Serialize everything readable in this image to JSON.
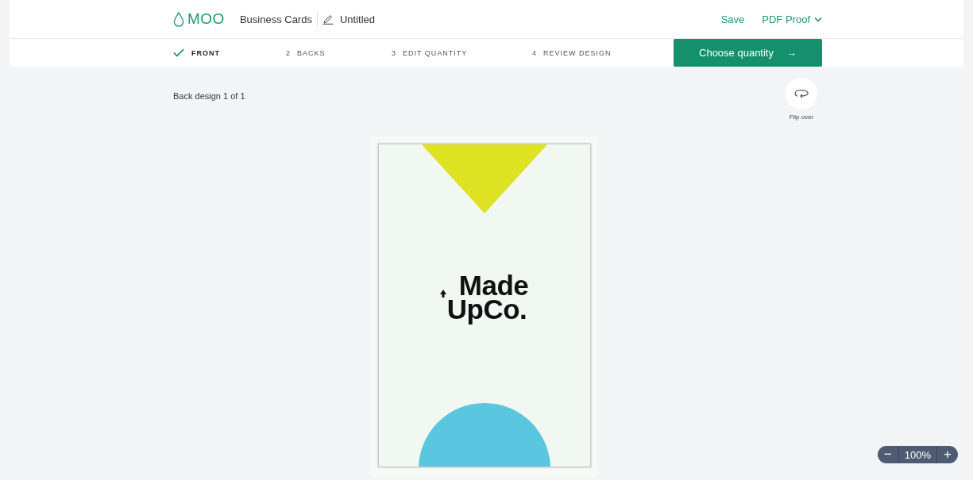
{
  "header": {
    "brand": "MOO",
    "product": "Business Cards",
    "document_title": "Untitled",
    "actions": [
      {
        "kind": "link",
        "label": "Save"
      },
      {
        "kind": "dropdown",
        "label": "PDF Proof"
      }
    ]
  },
  "steps": [
    {
      "label": "FRONT",
      "done": true,
      "selected": true
    },
    {
      "number": "2",
      "label": "BACKS",
      "done": false,
      "selected": false
    },
    {
      "number": "3",
      "label": "EDIT QUANTITY",
      "done": false,
      "selected": false
    },
    {
      "number": "4",
      "label": "REVIEW DESIGN",
      "done": false,
      "selected": false
    }
  ],
  "primary_button": {
    "label": "Choose quantity",
    "arrow": "→"
  },
  "design_label": "Back design 1 of 1",
  "flip": {
    "label": "Flip over"
  },
  "card": {
    "logo_lines": [
      "Made",
      "UpCo."
    ]
  },
  "zoom": {
    "minus": "−",
    "value": "100%",
    "plus": "+"
  }
}
